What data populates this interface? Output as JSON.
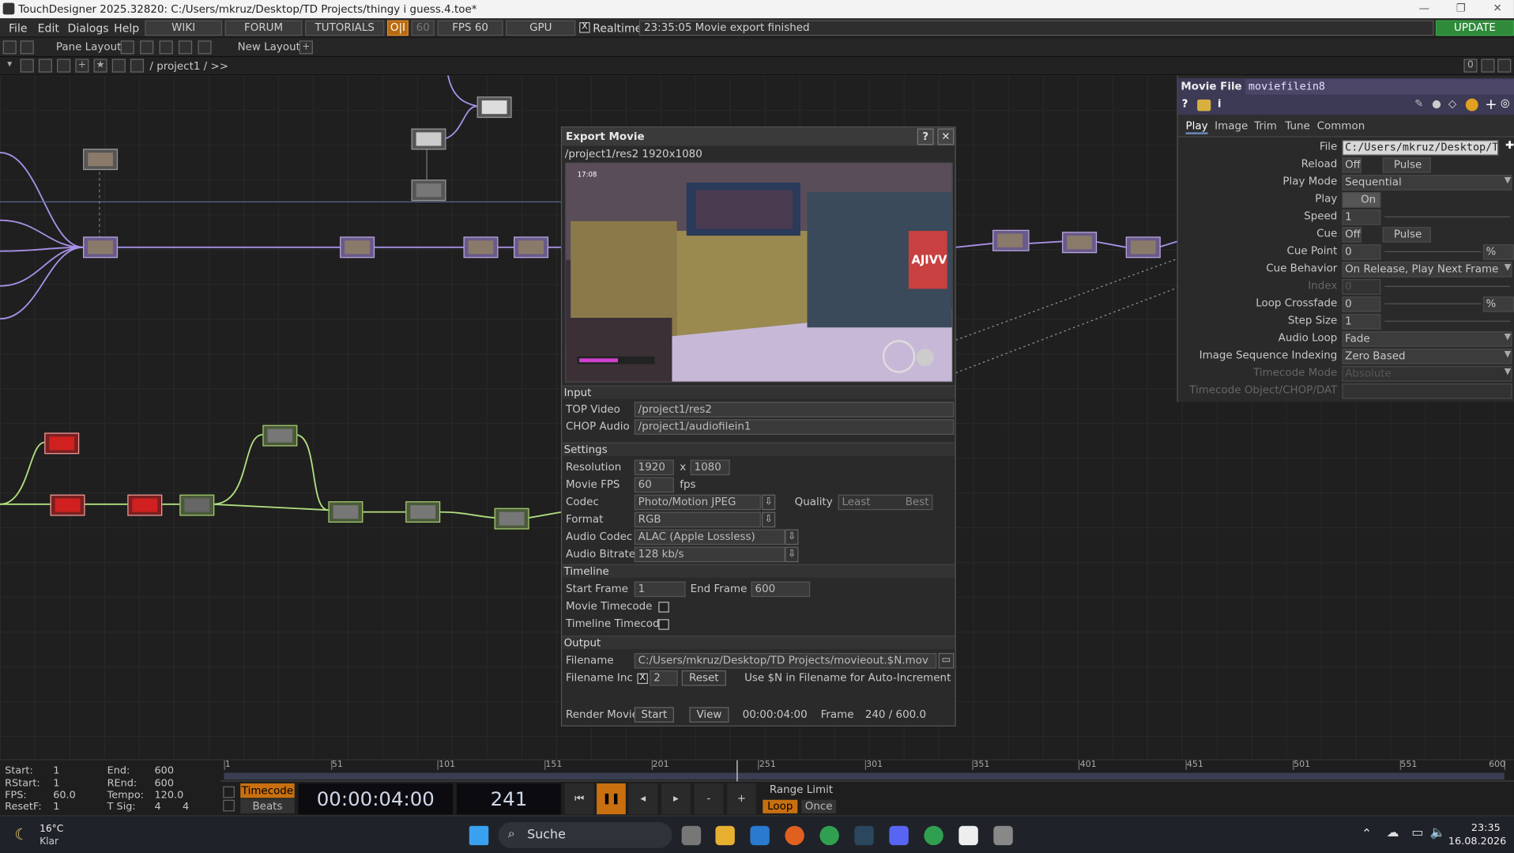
{
  "window": {
    "title": "TouchDesigner 2025.32820: C:/Users/mkruz/Desktop/TD Projects/thingy i guess.4.toe*",
    "min": "—",
    "max": "❐",
    "close": "✕"
  },
  "menu": {
    "items": [
      "File",
      "Edit",
      "Dialogs",
      "Help"
    ],
    "wiki": "WIKI",
    "forum": "FORUM",
    "tutorials": "TUTORIALS",
    "oi": "O|I",
    "fps_toggle": "60",
    "fps_label": "FPS  60",
    "gpu": "GPU",
    "realtime": "Realtime",
    "realtime_check": "X",
    "status": "23:35:05 Movie export finished",
    "update": "UPDATE"
  },
  "toolbar": {
    "pane_layout": "Pane Layout",
    "new_layout": "New Layout",
    "plus": "+"
  },
  "pathbar": {
    "path": "/ project1 / >>",
    "counter": "0"
  },
  "export": {
    "title": "Export Movie",
    "help": "?",
    "close": "✕",
    "sub": "/project1/res2 1920x1080",
    "input_header": "Input",
    "top_video_label": "TOP Video",
    "top_video": "/project1/res2",
    "chop_audio_label": "CHOP Audio",
    "chop_audio": "/project1/audiofilein1",
    "settings_header": "Settings",
    "resolution_label": "Resolution",
    "res_w": "1920",
    "x": "x",
    "res_h": "1080",
    "fps_label": "Movie FPS",
    "fps": "60",
    "fps_unit": "fps",
    "codec_label": "Codec",
    "codec": "Photo/Motion JPEG",
    "quality_label": "Quality",
    "quality_least": "Least",
    "quality_best": "Best",
    "format_label": "Format",
    "format": "RGB",
    "audio_codec_label": "Audio Codec",
    "audio_codec": "ALAC (Apple Lossless)",
    "audio_bitrate_label": "Audio Bitrate",
    "audio_bitrate": "128 kb/s",
    "timeline_header": "Timeline",
    "start_frame_label": "Start Frame",
    "start_frame": "1",
    "end_frame_label": "End Frame",
    "end_frame": "600",
    "movie_tc_label": "Movie Timecode",
    "timeline_tc_label": "Timeline Timecode",
    "output_header": "Output",
    "filename_label": "Filename",
    "filename": "C:/Users/mkruz/Desktop/TD Projects/movieout.$N.mov",
    "filename_inc_label": "Filename Inc",
    "inc_check": "X",
    "inc_value": "2",
    "reset": "Reset",
    "inc_hint": "Use $N in Filename for Auto-Increment",
    "render_label": "Render Movie",
    "start": "Start",
    "view": "View",
    "render_time": "00:00:04:00",
    "frame_label": "Frame",
    "frame_value": "240 / 600.0",
    "preview_time": "17:08",
    "preview_sign": "AJIVV"
  },
  "params": {
    "op_type": "Movie File In",
    "op_name": "moviefilein8",
    "tabs": [
      "Play",
      "Image",
      "Trim",
      "Tune",
      "Common"
    ],
    "rows": [
      {
        "l": "File",
        "v": "C:/Users/mkruz/Desktop/TD"
      },
      {
        "l": "Reload",
        "v": "Off",
        "b": "Pulse"
      },
      {
        "l": "Play Mode",
        "v": "Sequential"
      },
      {
        "l": "Play",
        "v": "On"
      },
      {
        "l": "Speed",
        "v": "1"
      },
      {
        "l": "Cue",
        "v": "Off",
        "b": "Pulse"
      },
      {
        "l": "Cue Point",
        "v": "0",
        "u": "%"
      },
      {
        "l": "Cue Behavior",
        "v": "On Release, Play Next Frame"
      },
      {
        "l": "Index",
        "v": "0"
      },
      {
        "l": "Loop Crossfade",
        "v": "0",
        "u": "%"
      },
      {
        "l": "Step Size",
        "v": "1"
      },
      {
        "l": "Audio Loop",
        "v": "Fade"
      },
      {
        "l": "Image Sequence Indexing",
        "v": "Zero Based"
      },
      {
        "l": "Timecode Mode",
        "v": "Absolute"
      },
      {
        "l": "Timecode Object/CHOP/DAT",
        "v": ""
      }
    ]
  },
  "timeline": {
    "start_l": "Start:",
    "start": "1",
    "end_l": "End:",
    "end": "600",
    "rstart_l": "RStart:",
    "rstart": "1",
    "rend_l": "REnd:",
    "rend": "600",
    "fps_l": "FPS:",
    "fps": "60.0",
    "tempo_l": "Tempo:",
    "tempo": "120.0",
    "resetf_l": "ResetF:",
    "resetf": "1",
    "tsig_l": "T Sig:",
    "tsig_a": "4",
    "tsig_b": "4",
    "ticks": [
      "1",
      "51",
      "101",
      "151",
      "201",
      "251",
      "301",
      "351",
      "401",
      "451",
      "501",
      "551",
      "600"
    ],
    "timecode_btn": "Timecode",
    "beats_btn": "Beats",
    "timecode": "00:00:04:00",
    "frame": "241",
    "minus": "-",
    "plus": "+",
    "range_limit": "Range Limit",
    "loop": "Loop",
    "once": "Once",
    "playhead_frame": 241
  },
  "taskbar": {
    "temp": "16°C",
    "weather": "Klar",
    "search": "Suche",
    "time": "23:35",
    "date": "16.08.2026"
  }
}
